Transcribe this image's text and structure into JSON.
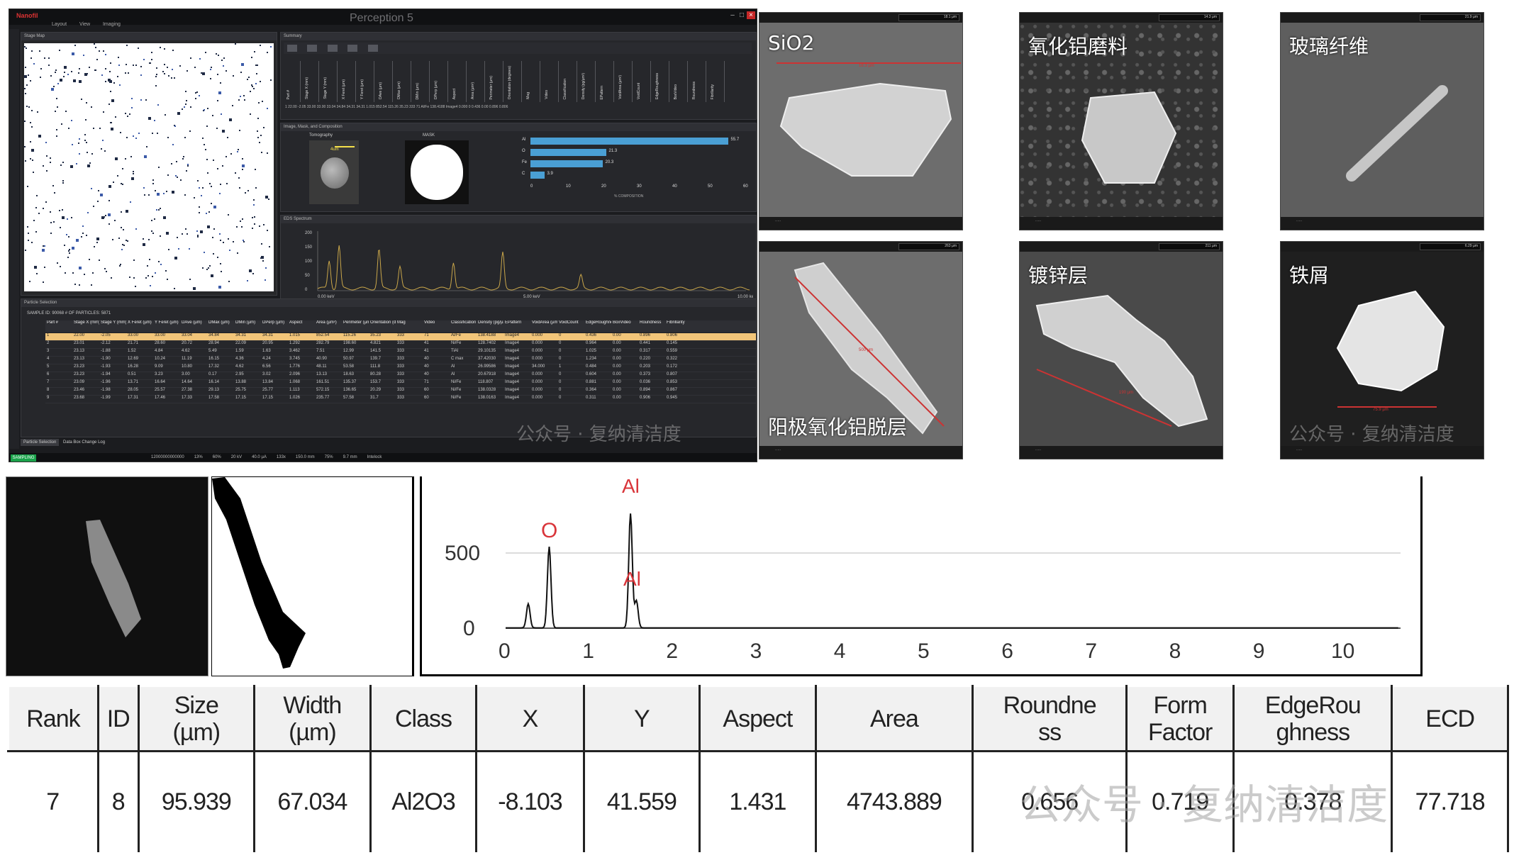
{
  "app": {
    "title": "Perception 5",
    "brand": "Nanofil",
    "menu": [
      "Layout",
      "View",
      "Imaging"
    ],
    "stage_map_title": "Stage Map",
    "summary_title": "Summary",
    "image_panel_title": "Image, Mask, and Composition",
    "thumb_label_1": "Tomography",
    "thumb_label_2": "MASK",
    "scale_text": "4um",
    "composition_axis_label": "% COMPOSITION",
    "composition_ticks": [
      "0",
      "10",
      "20",
      "30",
      "40",
      "50",
      "60"
    ],
    "composition": [
      {
        "el": "Al",
        "value": 55.7
      },
      {
        "el": "O",
        "value": 21.3
      },
      {
        "el": "Fe",
        "value": 20.3
      },
      {
        "el": "C",
        "value": 3.9
      }
    ],
    "spectrum_title": "EDS Spectrum",
    "spectrum_y_ticks": [
      "200",
      "150",
      "100",
      "50",
      "0"
    ],
    "spectrum_x_ticks": [
      "0.00 keV",
      "5.00 keV",
      "10.00 keV"
    ],
    "particle_selection_title": "Particle Selection",
    "sample_info": "SAMPLE ID: 90068   # OF PARTICLES: 5871",
    "summary_columns": [
      "Part #",
      "Stage X (mm)",
      "Stage Y (mm)",
      "X Feret (µm)",
      "Y Feret (µm)",
      "DAve (µm)",
      "DMax (µm)",
      "DMin (µm)",
      "DPerp (µm)",
      "Aspect",
      "Area (µm²)",
      "Perimeter (µm)",
      "Orientation (degrees)",
      "Mag",
      "Video",
      "Classification",
      "Density (pg/µm³)",
      "EPattern",
      "VoidArea (µm²)",
      "VoidCount",
      "EdgeRoughness",
      "BoxVideo",
      "Roundness",
      "Fibrillarity"
    ],
    "grid_columns": [
      "Part #",
      "Stage X (mm)",
      "Stage Y (mm)",
      "X Feret (µm)",
      "Y Feret (µm)",
      "DAve (µm)",
      "DMax (µm)",
      "DMin (µm)",
      "DPerp (µm)",
      "Aspect",
      "Area (µm²)",
      "Perimeter (µm)",
      "Orientation (degrees)",
      "Mag",
      "Video",
      "Classification",
      "Density (pg/µm³)",
      "EPattern",
      "VoidArea (µm²)",
      "VoidCount",
      "EdgeRoughness",
      "BoxVideo",
      "Roundness",
      "Fibrillarity"
    ],
    "grid_rows": [
      [
        "1",
        "22.00",
        "-2.05",
        "33.00",
        "33.00",
        "33.04",
        "34.84",
        "34.31",
        "34.31",
        "1.015",
        "852.54",
        "115.26",
        "35.23",
        "333",
        "71",
        "Al/Fe",
        "138.4188",
        "Image4",
        "0.000",
        "0",
        "0.436",
        "0.00",
        "0.896",
        "0.806"
      ],
      [
        "2",
        "23.01",
        "-2.12",
        "21.71",
        "28.60",
        "20.72",
        "28.94",
        "22.09",
        "20.95",
        "1.292",
        "282.79",
        "198.60",
        "4.821",
        "333",
        "41",
        "Ni/Fe",
        "128.7402",
        "Image4",
        "0.000",
        "0",
        "0.964",
        "0.00",
        "0.441",
        "0.145"
      ],
      [
        "3",
        "23.13",
        "-1.88",
        "1.52",
        "4.84",
        "4.62",
        "5.49",
        "1.59",
        "1.63",
        "3.462",
        "7.51",
        "12.99",
        "141.5",
        "333",
        "41",
        "TiAl",
        "29.10135",
        "Image4",
        "0.000",
        "0",
        "1.025",
        "0.00",
        "0.317",
        "0.559"
      ],
      [
        "4",
        "23.13",
        "-1.90",
        "12.69",
        "10.24",
        "11.19",
        "16.15",
        "4.36",
        "4.24",
        "3.745",
        "40.90",
        "50.97",
        "139.7",
        "333",
        "40",
        "C max",
        "37.42030",
        "Image4",
        "0.000",
        "0",
        "1.234",
        "0.00",
        "0.220",
        "0.322"
      ],
      [
        "5",
        "23.23",
        "-1.93",
        "16.28",
        "9.09",
        "10.80",
        "17.32",
        "4.62",
        "6.56",
        "1.776",
        "48.11",
        "53.58",
        "111.8",
        "333",
        "40",
        "Al",
        "26.99586",
        "Image4",
        "34.000",
        "1",
        "0.484",
        "0.00",
        "0.203",
        "0.172"
      ],
      [
        "6",
        "23.23",
        "-1.94",
        "0.51",
        "3.23",
        "3.00",
        "0.17",
        "2.95",
        "3.02",
        "2.096",
        "13.13",
        "18.63",
        "80.28",
        "333",
        "40",
        "Al",
        "20.67918",
        "Image4",
        "0.000",
        "0",
        "0.604",
        "0.00",
        "0.373",
        "0.807"
      ],
      [
        "7",
        "23.09",
        "-1.96",
        "13.71",
        "16.64",
        "14.64",
        "16.14",
        "13.88",
        "13.84",
        "1.068",
        "161.51",
        "135.37",
        "153.7",
        "333",
        "71",
        "Ni/Fe",
        "118.807",
        "Image4",
        "0.000",
        "0",
        "0.881",
        "0.00",
        "0.036",
        "0.853"
      ],
      [
        "8",
        "23.46",
        "-1.98",
        "28.05",
        "25.57",
        "27.38",
        "29.13",
        "25.75",
        "25.77",
        "1.113",
        "572.15",
        "136.65",
        "20.29",
        "333",
        "60",
        "Ni/Fe",
        "138.0328",
        "Image4",
        "0.000",
        "0",
        "0.364",
        "0.00",
        "0.894",
        "0.867"
      ],
      [
        "9",
        "23.68",
        "-1.99",
        "17.31",
        "17.46",
        "17.33",
        "17.58",
        "17.15",
        "17.15",
        "1.026",
        "235.77",
        "57.58",
        "31.7",
        "333",
        "60",
        "Ni/Fe",
        "138.0163",
        "Image4",
        "0.000",
        "0",
        "0.311",
        "0.00",
        "0.906",
        "0.945"
      ]
    ],
    "status_state": "SAMPLING",
    "tabs": [
      "Particle Selection",
      "Data Box Change Log"
    ],
    "status_items": [
      "12000000000000",
      "13%",
      "60%",
      "20 kV",
      "40.0 µA",
      "133x",
      "150.0 mm",
      "75%",
      "9.7 mm",
      "Intelock"
    ]
  },
  "sem": [
    {
      "label": "SiO2",
      "scale": "18.1 µm",
      "measure": "18.3 µm"
    },
    {
      "label": "氧化铝磨料",
      "scale": "14.3 µm",
      "measure": ""
    },
    {
      "label": "玻璃纤维",
      "scale": "21.9 µm",
      "measure": ""
    },
    {
      "label": "阳极氧化铝脱层",
      "scale": "263 µm",
      "measure": "500 µm"
    },
    {
      "label": "镀锌层",
      "scale": "211 µm",
      "measure": "190 µm"
    },
    {
      "label": "铁屑",
      "scale": "6.29 µm",
      "measure": "75.9 µm"
    }
  ],
  "watermark": {
    "small": "公众号 · 复纳清洁度",
    "big": "公众号 · 复纳清洁度"
  },
  "spectrum": {
    "y_ticks": [
      "500",
      "0"
    ],
    "x_ticks": [
      "0",
      "1",
      "2",
      "3",
      "4",
      "5",
      "6",
      "7",
      "8",
      "9",
      "10"
    ],
    "peak_labels": [
      "O",
      "Al",
      "Al"
    ]
  },
  "table": {
    "headers": [
      "Rank",
      "ID",
      "Size (µm)",
      "Width (µm)",
      "Class",
      "X",
      "Y",
      "Aspect",
      "Area",
      "Roundness",
      "Form Factor",
      "EdgeRoughness",
      "ECD"
    ],
    "header_lines": [
      [
        "Rank"
      ],
      [
        "ID"
      ],
      [
        "Size",
        "(µm)"
      ],
      [
        "Width",
        "(µm)"
      ],
      [
        "Class"
      ],
      [
        "X"
      ],
      [
        "Y"
      ],
      [
        "Aspect"
      ],
      [
        "Area"
      ],
      [
        "Roundne",
        "ss"
      ],
      [
        "Form",
        "Factor"
      ],
      [
        "EdgeRou",
        "ghness"
      ],
      [
        "ECD"
      ]
    ],
    "row": [
      "7",
      "8",
      "95.939",
      "67.034",
      "Al2O3",
      "-8.103",
      "41.559",
      "1.431",
      "4743.889",
      "0.656",
      "0.719",
      "0.378",
      "77.718"
    ]
  }
}
